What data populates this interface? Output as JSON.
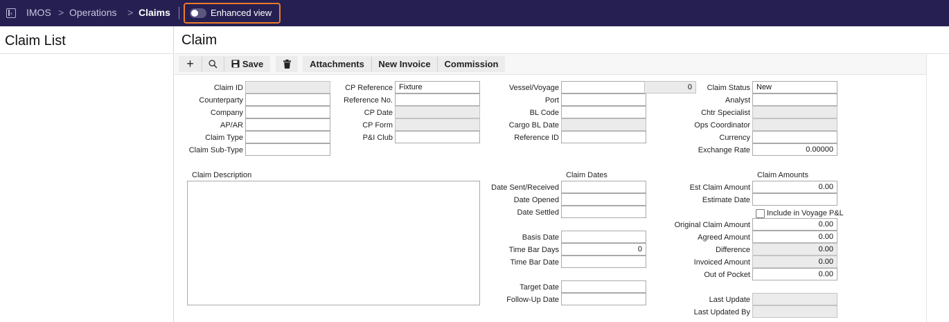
{
  "header": {
    "breadcrumbs": [
      "IMOS",
      "Operations",
      "Claims"
    ],
    "separator": ">",
    "enhanced_view_label": "Enhanced view",
    "enhanced_view_on": false
  },
  "left_panel": {
    "title": "Claim List"
  },
  "main": {
    "title": "Claim"
  },
  "toolbar": {
    "add_icon": "+",
    "search_icon": "search-icon",
    "save_label": "Save",
    "delete_icon": "trash-icon",
    "attachments_label": "Attachments",
    "new_invoice_label": "New Invoice",
    "commission_label": "Commission"
  },
  "col1": {
    "claim_id": {
      "label": "Claim ID",
      "value": ""
    },
    "counterparty": {
      "label": "Counterparty",
      "value": ""
    },
    "company": {
      "label": "Company",
      "value": ""
    },
    "ap_ar": {
      "label": "AP/AR",
      "value": ""
    },
    "claim_type": {
      "label": "Claim Type",
      "value": ""
    },
    "claim_sub_type": {
      "label": "Claim Sub-Type",
      "value": ""
    }
  },
  "col2": {
    "cp_reference": {
      "label": "CP Reference",
      "value": "Fixture"
    },
    "reference_no": {
      "label": "Reference No.",
      "value": ""
    },
    "cp_date": {
      "label": "CP Date",
      "value": ""
    },
    "cp_form": {
      "label": "CP Form",
      "value": ""
    },
    "pi_club": {
      "label": "P&I Club",
      "value": ""
    }
  },
  "col3": {
    "vessel_voyage": {
      "label": "Vessel/Voyage",
      "value": "",
      "voyage_no": "0"
    },
    "port": {
      "label": "Port",
      "value": ""
    },
    "bl_code": {
      "label": "BL Code",
      "value": ""
    },
    "cargo_bl_date": {
      "label": "Cargo BL Date",
      "value": ""
    },
    "reference_id": {
      "label": "Reference ID",
      "value": ""
    }
  },
  "col4": {
    "claim_status": {
      "label": "Claim Status",
      "value": "New"
    },
    "analyst": {
      "label": "Analyst",
      "value": ""
    },
    "chtr_specialist": {
      "label": "Chtr Specialist",
      "value": ""
    },
    "ops_coordinator": {
      "label": "Ops Coordinator",
      "value": ""
    },
    "currency": {
      "label": "Currency",
      "value": ""
    },
    "exchange_rate": {
      "label": "Exchange Rate",
      "value": "0.00000"
    }
  },
  "description": {
    "label": "Claim Description",
    "value": ""
  },
  "claim_dates": {
    "title": "Claim Dates",
    "date_sent_received": {
      "label": "Date Sent/Received",
      "value": ""
    },
    "date_opened": {
      "label": "Date Opened",
      "value": ""
    },
    "date_settled": {
      "label": "Date Settled",
      "value": ""
    },
    "basis_date": {
      "label": "Basis Date",
      "value": ""
    },
    "time_bar_days": {
      "label": "Time Bar Days",
      "value": "0"
    },
    "time_bar_date": {
      "label": "Time Bar Date",
      "value": ""
    },
    "target_date": {
      "label": "Target Date",
      "value": ""
    },
    "follow_up_date": {
      "label": "Follow-Up Date",
      "value": ""
    }
  },
  "claim_amounts": {
    "title": "Claim Amounts",
    "est_claim_amount": {
      "label": "Est Claim Amount",
      "value": "0.00"
    },
    "estimate_date": {
      "label": "Estimate Date",
      "value": ""
    },
    "include_voyage_pl": {
      "label": "Include in Voyage P&L",
      "checked": false
    },
    "original_claim_amount": {
      "label": "Original Claim Amount",
      "value": "0.00"
    },
    "agreed_amount": {
      "label": "Agreed Amount",
      "value": "0.00"
    },
    "difference": {
      "label": "Difference",
      "value": "0.00"
    },
    "invoiced_amount": {
      "label": "Invoiced Amount",
      "value": "0.00"
    },
    "out_of_pocket": {
      "label": "Out of Pocket",
      "value": "0.00"
    },
    "last_update": {
      "label": "Last Update",
      "value": ""
    },
    "last_updated_by": {
      "label": "Last Updated By",
      "value": ""
    }
  },
  "colors": {
    "topbar": "#262052",
    "highlight": "#f07a2a"
  }
}
